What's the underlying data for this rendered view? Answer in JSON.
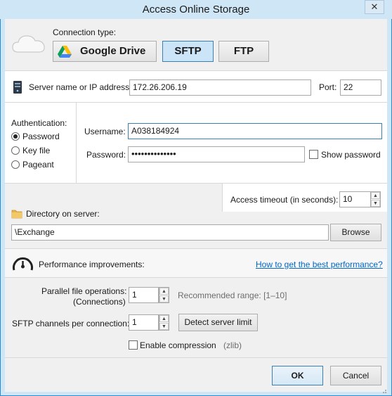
{
  "window": {
    "title": "Access Online Storage",
    "close": "✕"
  },
  "connection": {
    "label": "Connection type:",
    "options": [
      {
        "label": "Google Drive",
        "selected": false
      },
      {
        "label": "SFTP",
        "selected": true
      },
      {
        "label": "FTP",
        "selected": false
      }
    ]
  },
  "server": {
    "label": "Server name or IP address:",
    "value": "172.26.206.19",
    "port_label": "Port:",
    "port_value": "22"
  },
  "auth": {
    "label": "Authentication:",
    "options": [
      {
        "label": "Password",
        "selected": true
      },
      {
        "label": "Key file",
        "selected": false
      },
      {
        "label": "Pageant",
        "selected": false
      }
    ],
    "username_label": "Username:",
    "username_value": "A038184924",
    "password_label": "Password:",
    "password_value": "••••••••••••••",
    "show_password_label": "Show password",
    "show_password_checked": false
  },
  "timeout": {
    "label": "Access timeout (in seconds):",
    "value": "10"
  },
  "directory": {
    "label": "Directory on server:",
    "value": "\\Exchange",
    "browse": "Browse"
  },
  "performance": {
    "label": "Performance improvements:",
    "link": "How to get the best performance?",
    "parallel_label_line1": "Parallel file operations:",
    "parallel_label_line2": "(Connections)",
    "parallel_value": "1",
    "parallel_hint": "Recommended range: [1–10]",
    "channels_label": "SFTP channels per connection:",
    "channels_value": "1",
    "detect_button": "Detect server limit",
    "compression_label": "Enable compression",
    "compression_hint": "(zlib)",
    "compression_checked": false
  },
  "footer": {
    "ok": "OK",
    "cancel": "Cancel"
  },
  "colors": {
    "accent": "#2a8dd4",
    "selected_bg": "#cce4f7",
    "link": "#0066cc"
  },
  "icons": [
    "close-icon",
    "cloud-icon",
    "google-drive-icon",
    "server-icon",
    "folder-icon",
    "speedometer-icon",
    "spin-up-icon",
    "spin-down-icon",
    "resize-grip-icon"
  ]
}
